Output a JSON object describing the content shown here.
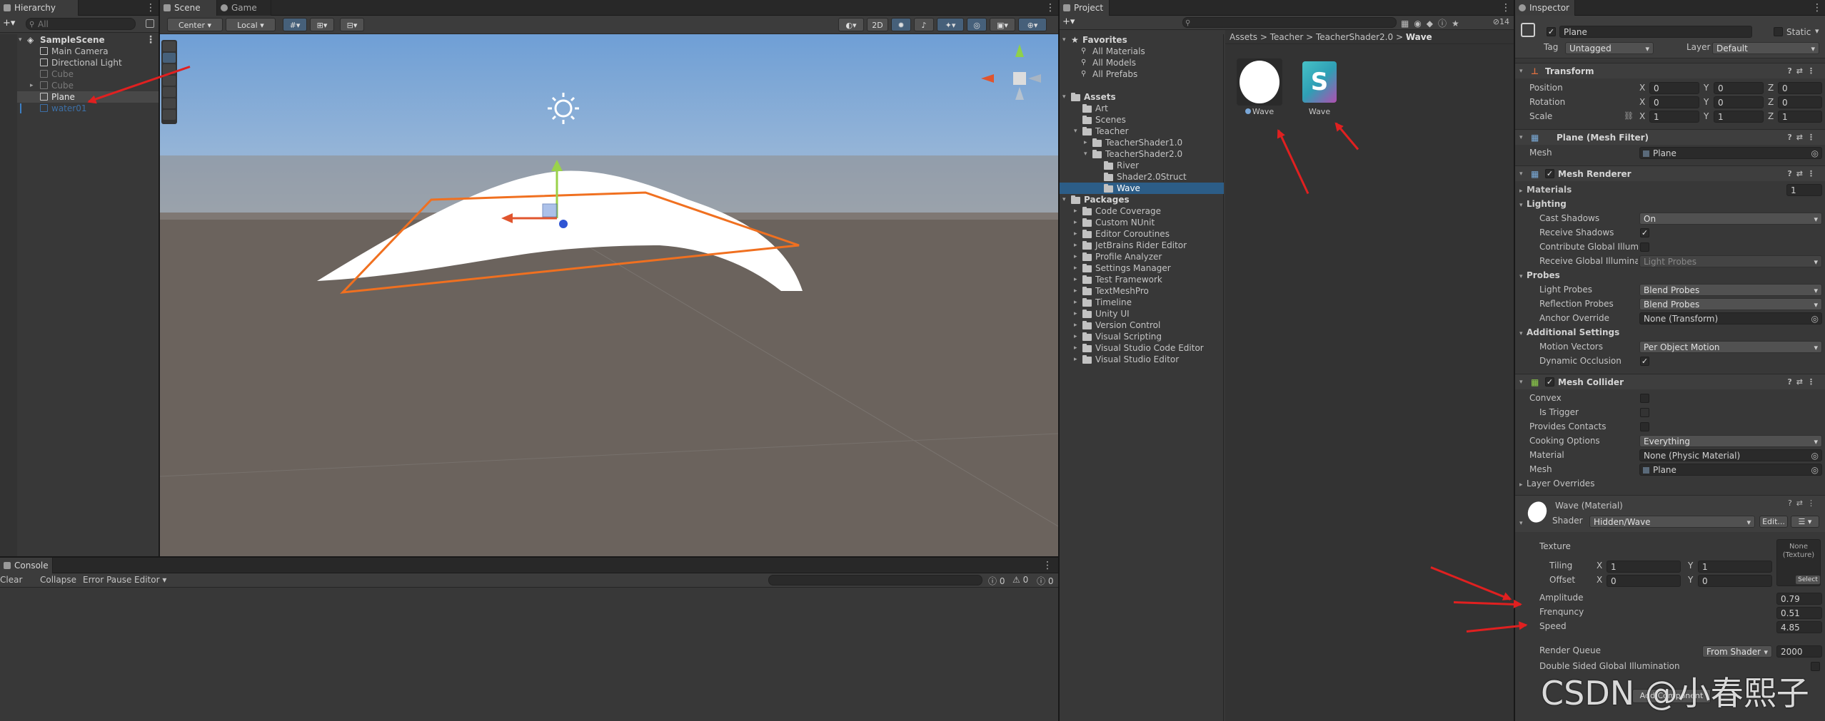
{
  "hierarchy": {
    "tab": "Hierarchy",
    "search_placeholder": "All",
    "add_label": "+▾",
    "items": [
      {
        "label": "SampleScene"
      },
      {
        "label": "Main Camera"
      },
      {
        "label": "Directional Light"
      },
      {
        "label": "Cube"
      },
      {
        "label": "Cube"
      },
      {
        "label": "Plane"
      },
      {
        "label": "water01"
      }
    ]
  },
  "scene": {
    "tabs": [
      "Scene",
      "Game"
    ],
    "pivot": "Center",
    "space": "Local",
    "mode_2d": "2D"
  },
  "console": {
    "tab": "Console",
    "buttons": [
      "Clear",
      "Collapse",
      "Error Pause",
      "Editor"
    ],
    "counts": [
      "0",
      "0",
      "0"
    ]
  },
  "project": {
    "tab": "Project",
    "search_count": "14",
    "breadcrumb": [
      "Assets",
      "Teacher",
      "TeacherShader2.0",
      "Wave"
    ],
    "tree": [
      {
        "label": "Favorites"
      },
      {
        "label": "All Materials"
      },
      {
        "label": "All Models"
      },
      {
        "label": "All Prefabs"
      },
      {
        "label": "Assets"
      },
      {
        "label": "Art"
      },
      {
        "label": "Scenes"
      },
      {
        "label": "Teacher"
      },
      {
        "label": "TeacherShader1.0"
      },
      {
        "label": "TeacherShader2.0"
      },
      {
        "label": "River"
      },
      {
        "label": "Shader2.0Struct"
      },
      {
        "label": "Wave"
      },
      {
        "label": "Packages"
      },
      {
        "label": "Code Coverage"
      },
      {
        "label": "Custom NUnit"
      },
      {
        "label": "Editor Coroutines"
      },
      {
        "label": "JetBrains Rider Editor"
      },
      {
        "label": "Profile Analyzer"
      },
      {
        "label": "Settings Manager"
      },
      {
        "label": "Test Framework"
      },
      {
        "label": "TextMeshPro"
      },
      {
        "label": "Timeline"
      },
      {
        "label": "Unity UI"
      },
      {
        "label": "Version Control"
      },
      {
        "label": "Visual Scripting"
      },
      {
        "label": "Visual Studio Code Editor"
      },
      {
        "label": "Visual Studio Editor"
      }
    ],
    "assets": [
      {
        "label": "Wave",
        "icon": "material-sphere-icon"
      },
      {
        "label": "Wave",
        "icon": "shader-s-icon",
        "glyph": "S"
      }
    ]
  },
  "inspector": {
    "tab": "Inspector",
    "object_name": "Plane",
    "static_label": "Static",
    "tag_label": "Tag",
    "tag_value": "Untagged",
    "layer_label": "Layer",
    "layer_value": "Default",
    "transform": {
      "title": "Transform",
      "rows": [
        {
          "label": "Position",
          "x": "0",
          "y": "0",
          "z": "0"
        },
        {
          "label": "Rotation",
          "x": "0",
          "y": "0",
          "z": "0"
        },
        {
          "label": "Scale",
          "x": "1",
          "y": "1",
          "z": "1"
        }
      ]
    },
    "mesh_filter": {
      "title": "Plane (Mesh Filter)",
      "mesh_label": "Mesh",
      "mesh_value": "Plane"
    },
    "mesh_renderer": {
      "title": "Mesh Renderer",
      "materials_label": "Materials",
      "materials_count": "1",
      "lighting_label": "Lighting",
      "cast_shadows_label": "Cast Shadows",
      "cast_shadows_value": "On",
      "receive_shadows_label": "Receive Shadows",
      "contribute_gi_label": "Contribute Global Illumina",
      "receive_gi_label": "Receive Global Illuminati",
      "receive_gi_value": "Light Probes",
      "probes_label": "Probes",
      "light_probes_label": "Light Probes",
      "light_probes_value": "Blend Probes",
      "reflection_probes_label": "Reflection Probes",
      "reflection_probes_value": "Blend Probes",
      "anchor_override_label": "Anchor Override",
      "anchor_override_value": "None (Transform)",
      "additional_label": "Additional Settings",
      "motion_vectors_label": "Motion Vectors",
      "motion_vectors_value": "Per Object Motion",
      "dynamic_occlusion_label": "Dynamic Occlusion"
    },
    "mesh_collider": {
      "title": "Mesh Collider",
      "convex_label": "Convex",
      "is_trigger_label": "Is Trigger",
      "provides_contacts_label": "Provides Contacts",
      "cooking_label": "Cooking Options",
      "cooking_value": "Everything",
      "material_label": "Material",
      "material_value": "None (Physic Material)",
      "mesh_label": "Mesh",
      "mesh_value": "Plane",
      "layer_overrides_label": "Layer Overrides"
    },
    "material": {
      "title": "Wave (Material)",
      "shader_label": "Shader",
      "shader_value": "Hidden/Wave",
      "edit_label": "Edit...",
      "texture_label": "Texture",
      "texture_slot": "None (Texture)",
      "select_label": "Select",
      "tiling_label": "Tiling",
      "tiling_x": "1",
      "tiling_y": "1",
      "offset_label": "Offset",
      "offset_x": "0",
      "offset_y": "0",
      "amplitude_label": "Amplitude",
      "amplitude_value": "0.79",
      "frenquncy_label": "Frenquncy",
      "frenquncy_value": "0.51",
      "speed_label": "Speed",
      "speed_value": "4.85",
      "render_queue_label": "Render Queue",
      "render_queue_mode": "From Shader",
      "render_queue_value": "2000",
      "double_sided_label": "Double Sided Global Illumination"
    },
    "add_component": "Add Component"
  },
  "watermark": "CSDN @小春熙子",
  "colors": {
    "selection": "#2c5d87",
    "annotation_arrow": "#e02020",
    "selection_outline": "#f07020"
  }
}
